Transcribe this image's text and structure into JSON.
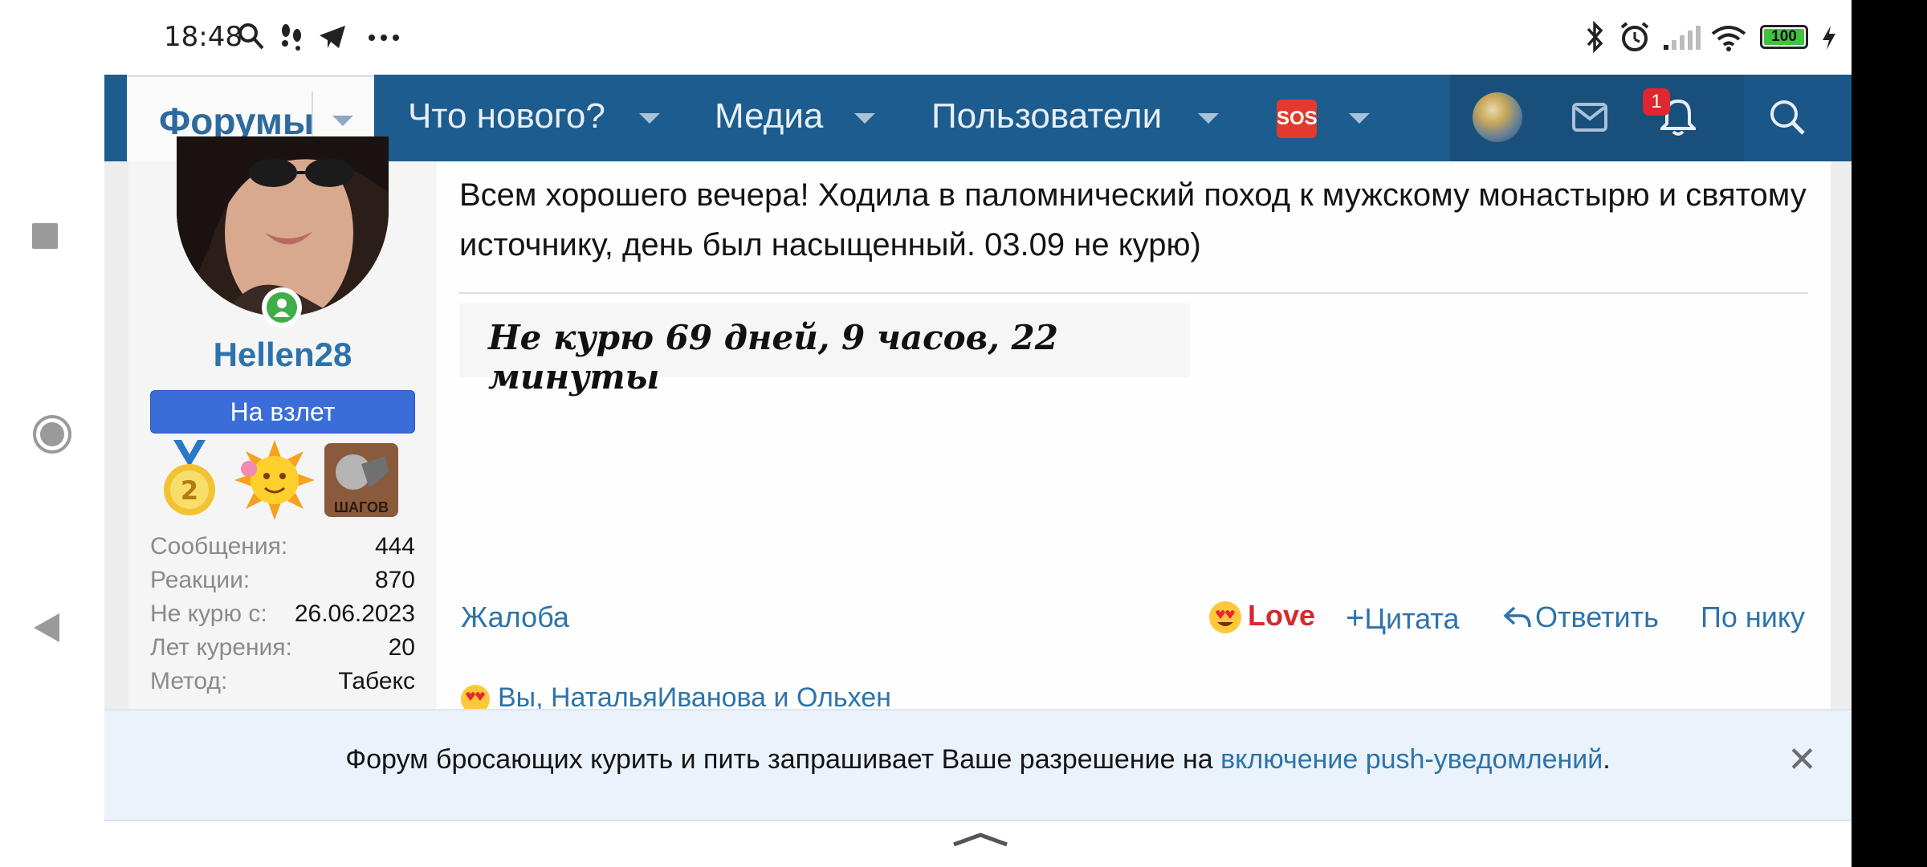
{
  "status_bar": {
    "time": "18:48",
    "battery": "100",
    "icons": [
      "search-icon",
      "steps-icon",
      "telegram-icon",
      "more-icon",
      "bluetooth-icon",
      "alarm-icon",
      "signal-icon",
      "wifi-icon",
      "battery-icon",
      "charging-icon"
    ]
  },
  "nav": {
    "active_tab": "Форумы",
    "items": [
      "Что нового?",
      "Медиа",
      "Пользователи"
    ],
    "sos_icon": "sos-icon",
    "notification_count": "1",
    "accent": "#1c5c8e"
  },
  "user": {
    "name": "Hellen28",
    "title": "На взлет",
    "trophies": [
      "medal-2-icon",
      "sun-flower-icon",
      "steps-badge-icon"
    ],
    "trophy_badge_text": "ШАГОВ",
    "stats": [
      {
        "label": "Сообщения:",
        "value": "444"
      },
      {
        "label": "Реакции:",
        "value": "870"
      },
      {
        "label": "Не курю с:",
        "value": "26.06.2023"
      },
      {
        "label": "Лет курения:",
        "value": "20"
      },
      {
        "label": "Метод:",
        "value": "Табекс"
      }
    ]
  },
  "post": {
    "text": "Всем хорошего вечера! Ходила в паломнический поход к мужскому монастырю и святому источнику, день был насыщенный. 03.09 не курю)",
    "signature": "Не курю  69 дней, 9 часов, 22 минуты",
    "actions": {
      "report": "Жалоба",
      "love": "Love",
      "quote": "Цитата",
      "reply": "Ответить",
      "by_nick": "По нику"
    },
    "reactions_text": "Вы, НатальяИванова и Ольхен"
  },
  "push_banner": {
    "text_before": "Форум бросающих курить и пить запрашивает Ваше разрешение на ",
    "link": "включение push-уведомлений",
    "text_after": "."
  }
}
